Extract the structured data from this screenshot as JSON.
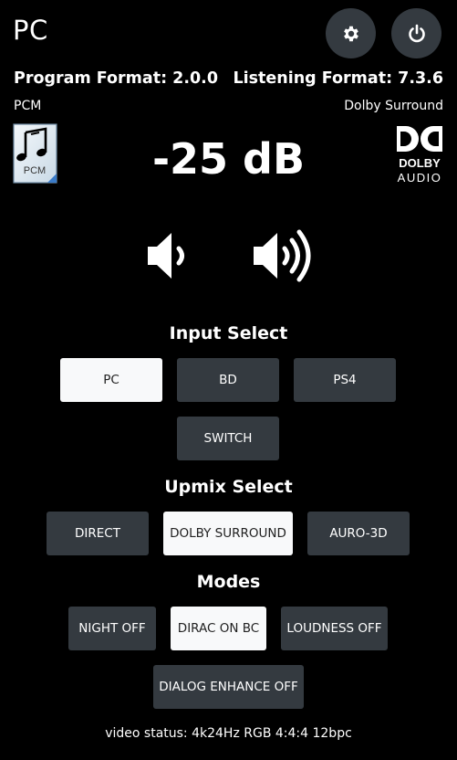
{
  "header": {
    "title": "PC",
    "settings_icon": "gear-icon",
    "power_icon": "power-icon"
  },
  "formats": {
    "program_label": "Program Format: 2.0.0",
    "listening_label": "Listening Format: 7.3.6",
    "program_sub": "PCM",
    "listening_sub": "Dolby Surround"
  },
  "badges": {
    "pcm_icon_text": "PCM",
    "dolby_line1": "DOLBY",
    "dolby_line2": "AUDIO"
  },
  "volume": {
    "value_label": "-25 dB",
    "down_icon": "volume-down-icon",
    "up_icon": "volume-up-icon"
  },
  "input_select": {
    "title": "Input Select",
    "buttons": [
      {
        "label": "PC",
        "active": true
      },
      {
        "label": "BD",
        "active": false
      },
      {
        "label": "PS4",
        "active": false
      },
      {
        "label": "SWITCH",
        "active": false
      }
    ]
  },
  "upmix_select": {
    "title": "Upmix Select",
    "buttons": [
      {
        "label": "DIRECT",
        "active": false
      },
      {
        "label": "DOLBY SURROUND",
        "active": true
      },
      {
        "label": "AURO-3D",
        "active": false
      }
    ]
  },
  "modes": {
    "title": "Modes",
    "buttons": [
      {
        "label": "NIGHT OFF",
        "active": false
      },
      {
        "label": "DIRAC ON BC",
        "active": true
      },
      {
        "label": "LOUDNESS OFF",
        "active": false
      },
      {
        "label": "DIALOG ENHANCE OFF",
        "active": false
      }
    ]
  },
  "status": {
    "video_status": "video status: 4k24Hz RGB 4:4:4 12bpc"
  },
  "colors": {
    "background": "#000000",
    "button": "#343a40",
    "button_active": "#f8f9fa",
    "text": "#ffffff"
  }
}
